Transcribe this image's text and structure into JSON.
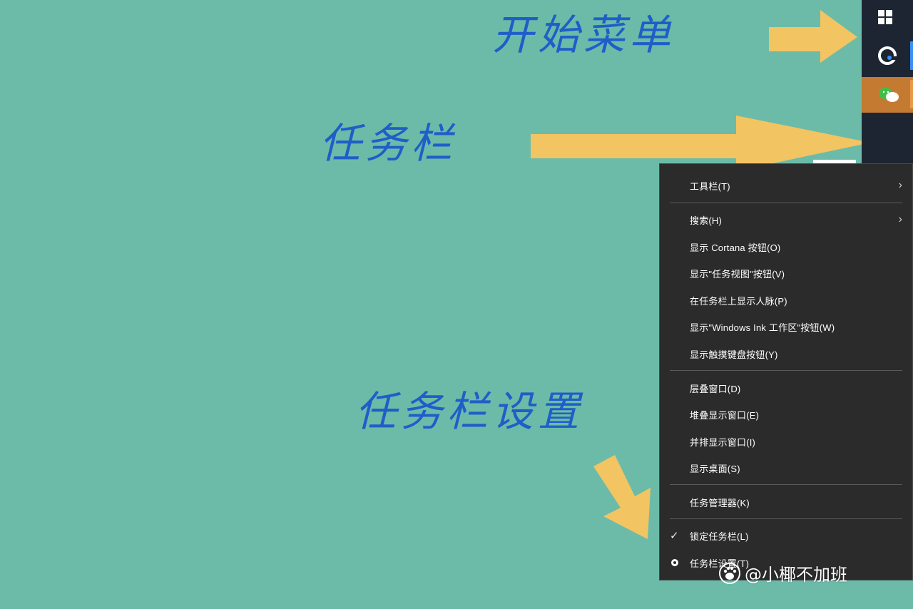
{
  "annotations": {
    "start_menu": "开始菜单",
    "taskbar": "任务栏",
    "taskbar_settings": "任务栏设置"
  },
  "colors": {
    "desktop_bg": "#6cbba8",
    "annotation_text": "#1f5ec8",
    "arrow": "#f3c462",
    "taskbar_bg": "#1d2532",
    "menu_bg": "#2b2b2b",
    "wechat_active": "#c57a32"
  },
  "taskbar": {
    "icons": [
      "windows-start-icon",
      "edge-icon",
      "wechat-icon"
    ]
  },
  "context_menu": {
    "items": [
      {
        "label": "工具栏(T)",
        "submenu": true
      },
      {
        "label": "搜索(H)",
        "submenu": true
      },
      {
        "label": "显示 Cortana 按钮(O)"
      },
      {
        "label": "显示\"任务视图\"按钮(V)"
      },
      {
        "label": "在任务栏上显示人脉(P)"
      },
      {
        "label": "显示\"Windows Ink 工作区\"按钮(W)"
      },
      {
        "label": "显示触摸键盘按钮(Y)"
      },
      {
        "label": "层叠窗口(D)"
      },
      {
        "label": "堆叠显示窗口(E)"
      },
      {
        "label": "并排显示窗口(I)"
      },
      {
        "label": "显示桌面(S)"
      },
      {
        "label": "任务管理器(K)"
      },
      {
        "label": "锁定任务栏(L)",
        "checked": true
      },
      {
        "label": "任务栏设置(T)",
        "icon": "gear-icon"
      }
    ],
    "chevron": "›",
    "check": "✓"
  },
  "watermark": {
    "text": "@小椰不加班"
  }
}
